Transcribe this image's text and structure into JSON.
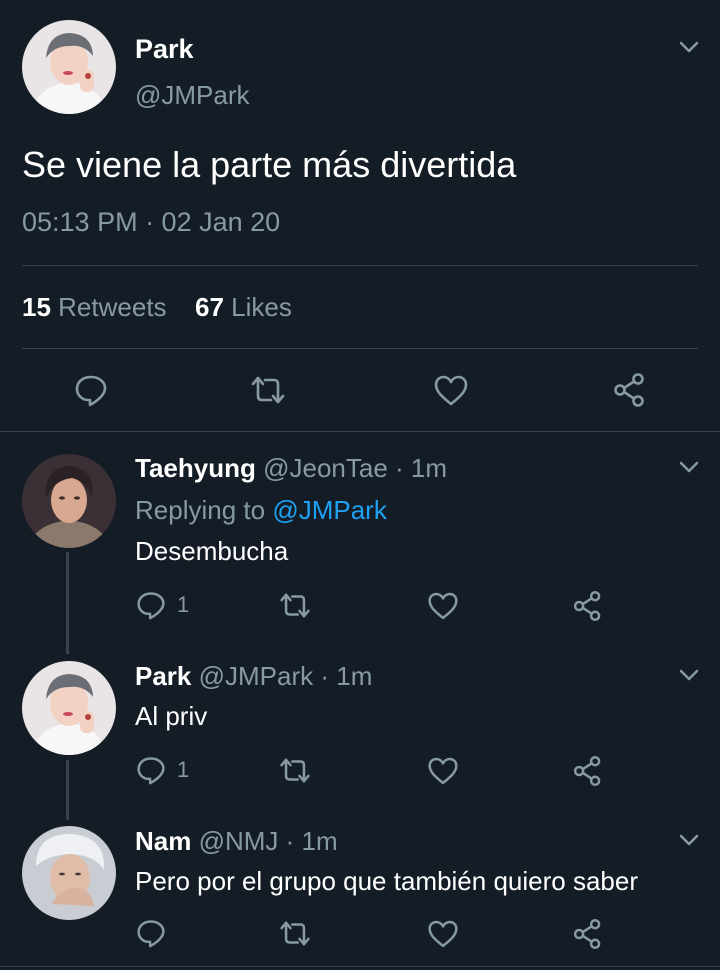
{
  "main_tweet": {
    "name": "Park",
    "handle": "@JMPark",
    "text": "Se viene la parte más divertida",
    "timestamp": "05:13 PM · 02 Jan 20",
    "retweets_count": "15",
    "retweets_label": "Retweets",
    "likes_count": "67",
    "likes_label": "Likes"
  },
  "replies": [
    {
      "name": "Taehyung",
      "handle": "@JeonTae",
      "time": "· 1m",
      "replying_prefix": "Replying to",
      "replying_to": "@JMPark",
      "text": "Desembucha",
      "reply_count": "1"
    },
    {
      "name": "Park",
      "handle": "@JMPark",
      "time": "· 1m",
      "text": "Al priv",
      "reply_count": "1"
    },
    {
      "name": "Nam",
      "handle": "@NMJ",
      "time": "· 1m",
      "text": "Pero por el grupo que también quiero saber",
      "reply_count": ""
    }
  ],
  "icons": [
    "chevron-down-icon",
    "reply-icon",
    "retweet-icon",
    "like-icon",
    "share-icon"
  ],
  "colors": {
    "background": "#141d26",
    "secondary_text": "#8899a6",
    "accent": "#1da1f2",
    "divider": "#38444d"
  }
}
